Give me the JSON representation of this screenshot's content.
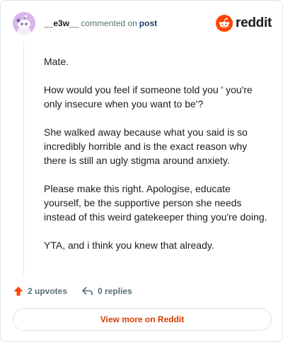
{
  "header": {
    "username": "__e3w__",
    "action_text": "commented on",
    "post_link": "post",
    "brand": "reddit"
  },
  "comment": {
    "paragraphs": [
      "Mate.",
      "How would you feel if someone told you ' you're only insecure when you want to be'?",
      "She walked away because what you said is so incredibly horrible and is the exact reason why there is still an ugly stigma around anxiety.",
      "Please make this right. Apologise, educate yourself, be the supportive person she needs instead of this weird gatekeeper thing you're doing.",
      "YTA, and i think you knew that already."
    ]
  },
  "footer": {
    "upvotes": "2 upvotes",
    "replies": "0 replies",
    "upvote_icon": "upvote-arrow-icon",
    "reply_icon": "reply-arrow-icon"
  },
  "cta": {
    "view_more": "View more on Reddit"
  },
  "colors": {
    "brand": "#ff4500",
    "accent_text": "#d93a00",
    "avatar_bg": "#d7b7ea"
  }
}
